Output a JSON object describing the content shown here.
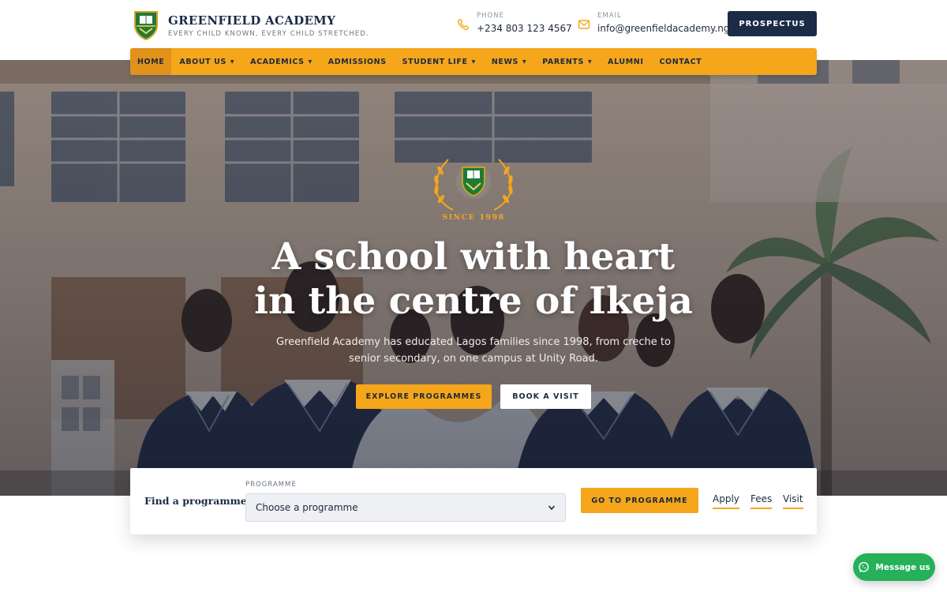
{
  "brand": {
    "name": "GREENFIELD ACADEMY",
    "tagline": "EVERY CHILD KNOWN, EVERY CHILD STRETCHED."
  },
  "contact": {
    "phone_label": "PHONE",
    "phone_value": "+234 803 123 4567",
    "email_label": "EMAIL",
    "email_value": "info@greenfieldacademy.ng"
  },
  "header": {
    "prospectus_label": "PROSPECTUS"
  },
  "nav": {
    "items": [
      {
        "label": "HOME",
        "active": true
      },
      {
        "label": "ABOUT US",
        "dropdown": true
      },
      {
        "label": "ACADEMICS",
        "dropdown": true
      },
      {
        "label": "ADMISSIONS"
      },
      {
        "label": "STUDENT LIFE",
        "dropdown": true
      },
      {
        "label": "NEWS",
        "dropdown": true
      },
      {
        "label": "PARENTS",
        "dropdown": true
      },
      {
        "label": "ALUMNI"
      },
      {
        "label": "CONTACT"
      }
    ]
  },
  "hero": {
    "since": "SINCE 1998",
    "title_line1": "A school with heart",
    "title_line2": "in the centre of Ikeja",
    "subtitle_line1": "Greenfield Academy has educated Lagos families since 1998, from creche to",
    "subtitle_line2": "senior secondary, on one campus at Unity Road.",
    "explore_label": "EXPLORE PROGRAMMES",
    "visit_label": "BOOK A VISIT"
  },
  "finder": {
    "title": "Find a programme",
    "programme_label": "PROGRAMME",
    "programme_placeholder": "Choose a programme",
    "go_label": "GO TO PROGRAMME",
    "quick_links": [
      "Apply",
      "Fees",
      "Visit"
    ]
  },
  "chat": {
    "label": "Message us"
  },
  "colors": {
    "accent": "#f5a61b",
    "navy": "#1b2b45",
    "whatsapp": "#25b05a"
  }
}
